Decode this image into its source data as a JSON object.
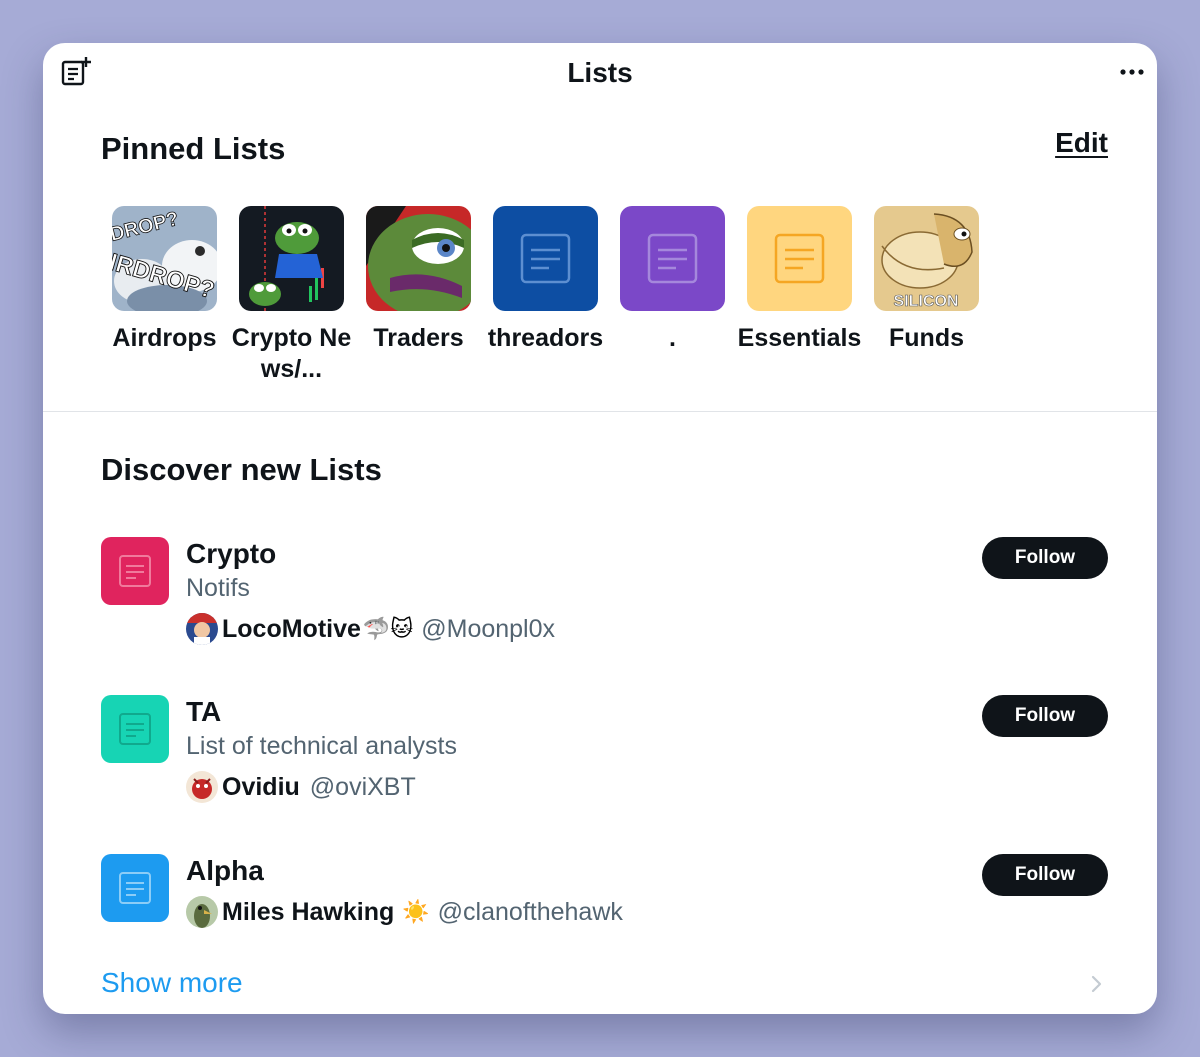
{
  "header": {
    "title": "Lists",
    "new_list_icon": "new-list-icon",
    "more_icon": "more-options-icon"
  },
  "pinned": {
    "title": "Pinned Lists",
    "edit_label": "Edit",
    "items": [
      {
        "label": "Airdrops",
        "thumb_text": [
          "DROP?",
          "IRDROP?"
        ]
      },
      {
        "label": "Crypto News/..."
      },
      {
        "label": "Traders"
      },
      {
        "label": "threadors",
        "color": "#0d4ea3"
      },
      {
        "label": ".",
        "color": "#7b48c8"
      },
      {
        "label": "Essentials",
        "color": "#ffd67f"
      },
      {
        "label": "Funds",
        "thumb_text": "SILICON"
      }
    ]
  },
  "discover": {
    "title": "Discover new Lists",
    "items": [
      {
        "name": "Crypto",
        "description": "Notifs",
        "color": "#e0245e",
        "owner_name": "LocoMotive",
        "owner_emoji": "🦈🐱",
        "owner_handle": "@Moonpl0x",
        "follow_label": "Follow"
      },
      {
        "name": "TA",
        "description": "List of technical analysts",
        "color": "#17d4b4",
        "owner_name": "Ovidiu",
        "owner_emoji": "",
        "owner_handle": "@oviXBT",
        "follow_label": "Follow"
      },
      {
        "name": "Alpha",
        "description": "",
        "color": "#1d9bf0",
        "owner_name": "Miles Hawking",
        "owner_emoji": "☀️",
        "owner_handle": "@clanofthehawk",
        "follow_label": "Follow"
      }
    ],
    "show_more": "Show more"
  }
}
